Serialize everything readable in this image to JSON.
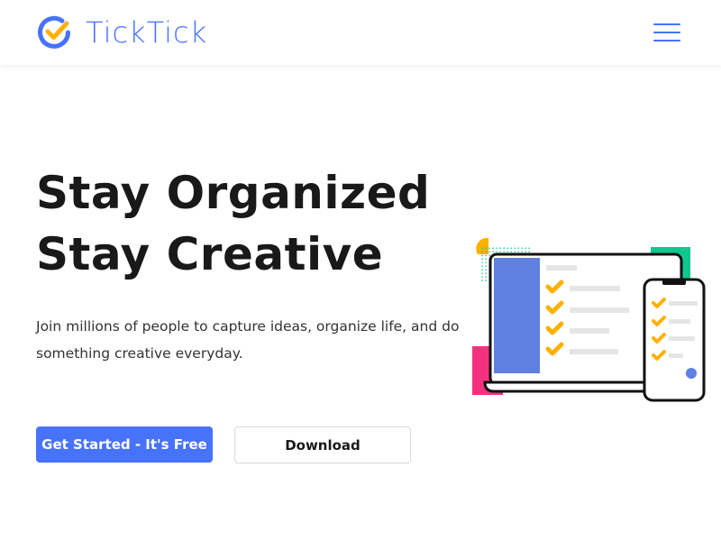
{
  "header": {
    "brand": "TickTick",
    "menu_icon": "hamburger-menu-icon"
  },
  "hero": {
    "title_line_1": "Stay Organized",
    "title_line_2": "Stay Creative",
    "description": "Join millions of people to capture ideas, organize life, and do something creative everyday.",
    "primary_cta": "Get Started - It's Free",
    "secondary_cta": "Download"
  },
  "illustration": {
    "icon": "devices-checklist-illustration"
  },
  "colors": {
    "brand_blue": "#4772FA",
    "check_yellow": "#FFB000",
    "accent_green": "#11C78E",
    "accent_pink": "#F5317F",
    "text_dark": "#191919"
  }
}
